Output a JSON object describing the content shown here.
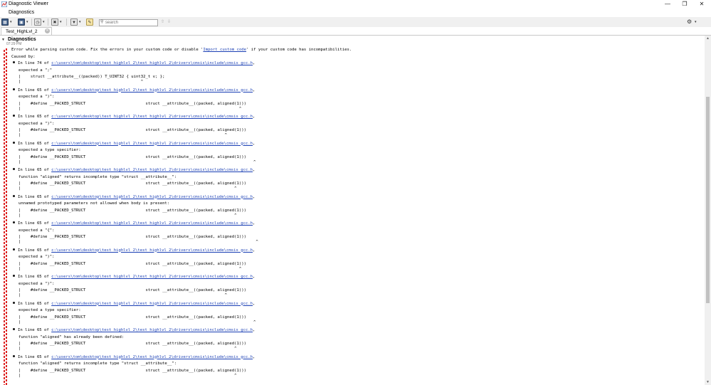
{
  "window": {
    "title": "Diagnostic Viewer"
  },
  "menubar": {
    "menu_label": "Diagnostics"
  },
  "toolbar": {
    "search_placeholder": "search",
    "buttons": [
      "table-view-icon",
      "save-icon",
      "clock-icon",
      "clear-icon",
      "filter-icon",
      "highlight-icon"
    ]
  },
  "tab": {
    "label": "Test_HighLvl_2"
  },
  "group": {
    "title": "Diagnostics",
    "time": "07:29 PM"
  },
  "message": {
    "pre": "Error while parsing custom code. Fix the errors in your custom code or disable '",
    "link": "Import custom code",
    "post": "' if your custom code has incompatibilities.",
    "caused_by": "Caused by:"
  },
  "errors": [
    {
      "loc_pre": "In line 74 of ",
      "path": "c:\\users\\tom\\desktop\\test_highlvl_2\\test_highlvl_2\\drivers\\cmsis\\include\\cmsis_gcc.h",
      "loc_post": ",",
      "expected": "expected a \";\"",
      "code": "struct __attribute__((packed)) T_UINT32 { uint32_t v; };",
      "caret": "                                              ^"
    },
    {
      "loc_pre": "In line 65 of ",
      "path": "c:\\users\\tom\\desktop\\test_highlvl_2\\test_highlvl_2\\drivers\\cmsis\\include\\cmsis_gcc.h",
      "loc_post": ",",
      "expected": "expected a \")\":",
      "code": "#define __PACKED_STRUCT                         struct __attribute__((packed, aligned(1)))",
      "caret": "                                                                                       ^"
    },
    {
      "loc_pre": "In line 65 of ",
      "path": "c:\\users\\tom\\desktop\\test_highlvl_2\\test_highlvl_2\\drivers\\cmsis\\include\\cmsis_gcc.h",
      "loc_post": ",",
      "expected": "expected a \")\":",
      "code": "#define __PACKED_STRUCT                         struct __attribute__((packed, aligned(1)))",
      "caret": "                                                                                 ^"
    },
    {
      "loc_pre": "In line 65 of ",
      "path": "c:\\users\\tom\\desktop\\test_highlvl_2\\test_highlvl_2\\drivers\\cmsis\\include\\cmsis_gcc.h",
      "loc_post": ",",
      "expected": "expected a type specifier:",
      "code": "#define __PACKED_STRUCT                         struct __attribute__((packed, aligned(1)))",
      "caret": "                                                                                             ^"
    },
    {
      "loc_pre": "In line 65 of ",
      "path": "c:\\users\\tom\\desktop\\test_highlvl_2\\test_highlvl_2\\drivers\\cmsis\\include\\cmsis_gcc.h",
      "loc_post": ",",
      "expected": "function \"aligned\" returns incomplete type \"struct __attribute__\":",
      "code": "#define __PACKED_STRUCT                         struct __attribute__((packed, aligned(1)))",
      "caret": "                                                                                     ^"
    },
    {
      "loc_pre": "In line 65 of ",
      "path": "c:\\users\\tom\\desktop\\test_highlvl_2\\test_highlvl_2\\drivers\\cmsis\\include\\cmsis_gcc.h",
      "loc_post": ",",
      "expected": "unnamed prototyped parameters not allowed when body is present:",
      "code": "#define __PACKED_STRUCT                         struct __attribute__((packed, aligned(1)))",
      "caret": "                                                                                     ^"
    },
    {
      "loc_pre": "In line 65 of ",
      "path": "c:\\users\\tom\\desktop\\test_highlvl_2\\test_highlvl_2\\drivers\\cmsis\\include\\cmsis_gcc.h",
      "loc_post": ",",
      "expected": "expected a \"{\":",
      "code": "#define __PACKED_STRUCT                         struct __attribute__((packed, aligned(1)))",
      "caret": "                                                                                              ^"
    },
    {
      "loc_pre": "In line 65 of ",
      "path": "c:\\users\\tom\\desktop\\test_highlvl_2\\test_highlvl_2\\drivers\\cmsis\\include\\cmsis_gcc.h",
      "loc_post": ",",
      "expected": "expected a \")\":",
      "code": "#define __PACKED_STRUCT                         struct __attribute__((packed, aligned(1)))",
      "caret": "                                                                                       ^"
    },
    {
      "loc_pre": "In line 65 of ",
      "path": "c:\\users\\tom\\desktop\\test_highlvl_2\\test_highlvl_2\\drivers\\cmsis\\include\\cmsis_gcc.h",
      "loc_post": ",",
      "expected": "expected a \")\":",
      "code": "#define __PACKED_STRUCT                         struct __attribute__((packed, aligned(1)))",
      "caret": "                                                                                 ^"
    },
    {
      "loc_pre": "In line 65 of ",
      "path": "c:\\users\\tom\\desktop\\test_highlvl_2\\test_highlvl_2\\drivers\\cmsis\\include\\cmsis_gcc.h",
      "loc_post": ",",
      "expected": "expected a type specifier:",
      "code": "#define __PACKED_STRUCT                         struct __attribute__((packed, aligned(1)))",
      "caret": "                                                                                             ^"
    },
    {
      "loc_pre": "In line 65 of ",
      "path": "c:\\users\\tom\\desktop\\test_highlvl_2\\test_highlvl_2\\drivers\\cmsis\\include\\cmsis_gcc.h",
      "loc_post": ",",
      "expected": "function \"aligned\" has already been defined:",
      "code": "#define __PACKED_STRUCT                         struct __attribute__((packed, aligned(1)))",
      "caret": "                                                                                     ^"
    },
    {
      "loc_pre": "In line 65 of ",
      "path": "c:\\users\\tom\\desktop\\test_highlvl_2\\test_highlvl_2\\drivers\\cmsis\\include\\cmsis_gcc.h",
      "loc_post": ",",
      "expected": "function \"aligned\" returns incomplete type \"struct __attribute__\":",
      "code": "#define __PACKED_STRUCT                         struct __attribute__((packed, aligned(1)))",
      "caret": "                                                                                     ^"
    }
  ],
  "colors": {
    "link": "#1a3fb4",
    "error_bar": "#dd2222",
    "toolbar_bg": "#f0f0f0"
  }
}
